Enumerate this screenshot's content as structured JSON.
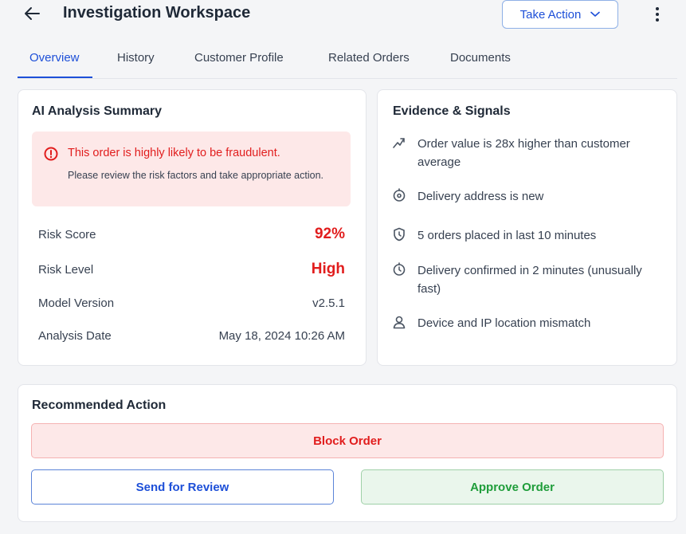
{
  "header": {
    "title": "Investigation Workspace",
    "take_action_label": "Take Action"
  },
  "tabs": [
    {
      "label": "Overview",
      "active": true
    },
    {
      "label": "History",
      "active": false
    },
    {
      "label": "Customer Profile",
      "active": false
    },
    {
      "label": "Related Orders",
      "active": false
    },
    {
      "label": "Documents",
      "active": false
    }
  ],
  "summary": {
    "title": "AI Analysis Summary",
    "alert_title": "This order is highly likely to be fraudulent.",
    "alert_text": "Please review the risk factors and take appropriate action.",
    "rows": [
      {
        "label": "Risk Score",
        "value": "92%"
      },
      {
        "label": "Risk Level",
        "value": "High"
      },
      {
        "label": "Model Version",
        "value": "v2.5.1"
      },
      {
        "label": "Analysis Date",
        "value": "May 18, 2024 10:26 AM"
      }
    ]
  },
  "evidence": {
    "title": "Evidence & Signals",
    "items": [
      {
        "text": "Order value is 28x higher than customer average",
        "icon": "trend-icon"
      },
      {
        "text": "Delivery address is new",
        "icon": "location-icon"
      },
      {
        "text": "5 orders placed in last 10 minutes",
        "icon": "shield-clock-icon"
      },
      {
        "text": "Delivery confirmed in 2 minutes (unusually fast)",
        "icon": "clock-icon"
      },
      {
        "text": "Device and IP location mismatch",
        "icon": "user-icon"
      }
    ]
  },
  "recommended": {
    "title": "Recommended Action",
    "block_label": "Block Order",
    "review_label": "Send for Review",
    "approve_label": "Approve Order"
  },
  "colors": {
    "accent": "#1d4fd8",
    "danger": "#e11d1d",
    "success": "#1f9d3a"
  }
}
